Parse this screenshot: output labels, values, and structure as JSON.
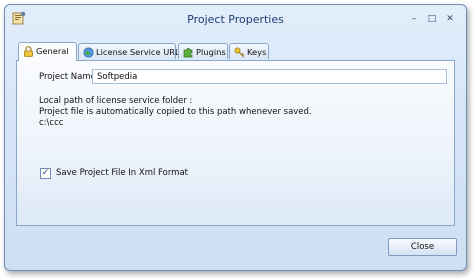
{
  "window": {
    "title": "Project Properties",
    "controls": {
      "minimize": "–",
      "maximize": "□",
      "close": "✕"
    }
  },
  "tabs": [
    {
      "label": "General",
      "icon": "lock-icon",
      "active": true
    },
    {
      "label": "License Service URL",
      "icon": "globe-icon",
      "active": false
    },
    {
      "label": "Plugins",
      "icon": "puzzle-icon",
      "active": false
    },
    {
      "label": "Keys",
      "icon": "key-icon",
      "active": false
    }
  ],
  "general": {
    "project_name_label": "Project Name",
    "project_name_value": "Softpedia",
    "local_path_line1": "Local path of license service folder :",
    "local_path_line2": "Project file is automatically copied to this path whenever saved.",
    "local_path_value": "c:\\ccc",
    "save_xml_label": "Save Project File In Xml Format",
    "save_xml_checked": true
  },
  "footer": {
    "close_label": "Close"
  },
  "colors": {
    "title_text": "#1e3f73",
    "border": "#8aa6cb",
    "window_bg": "#d6e5f7"
  }
}
